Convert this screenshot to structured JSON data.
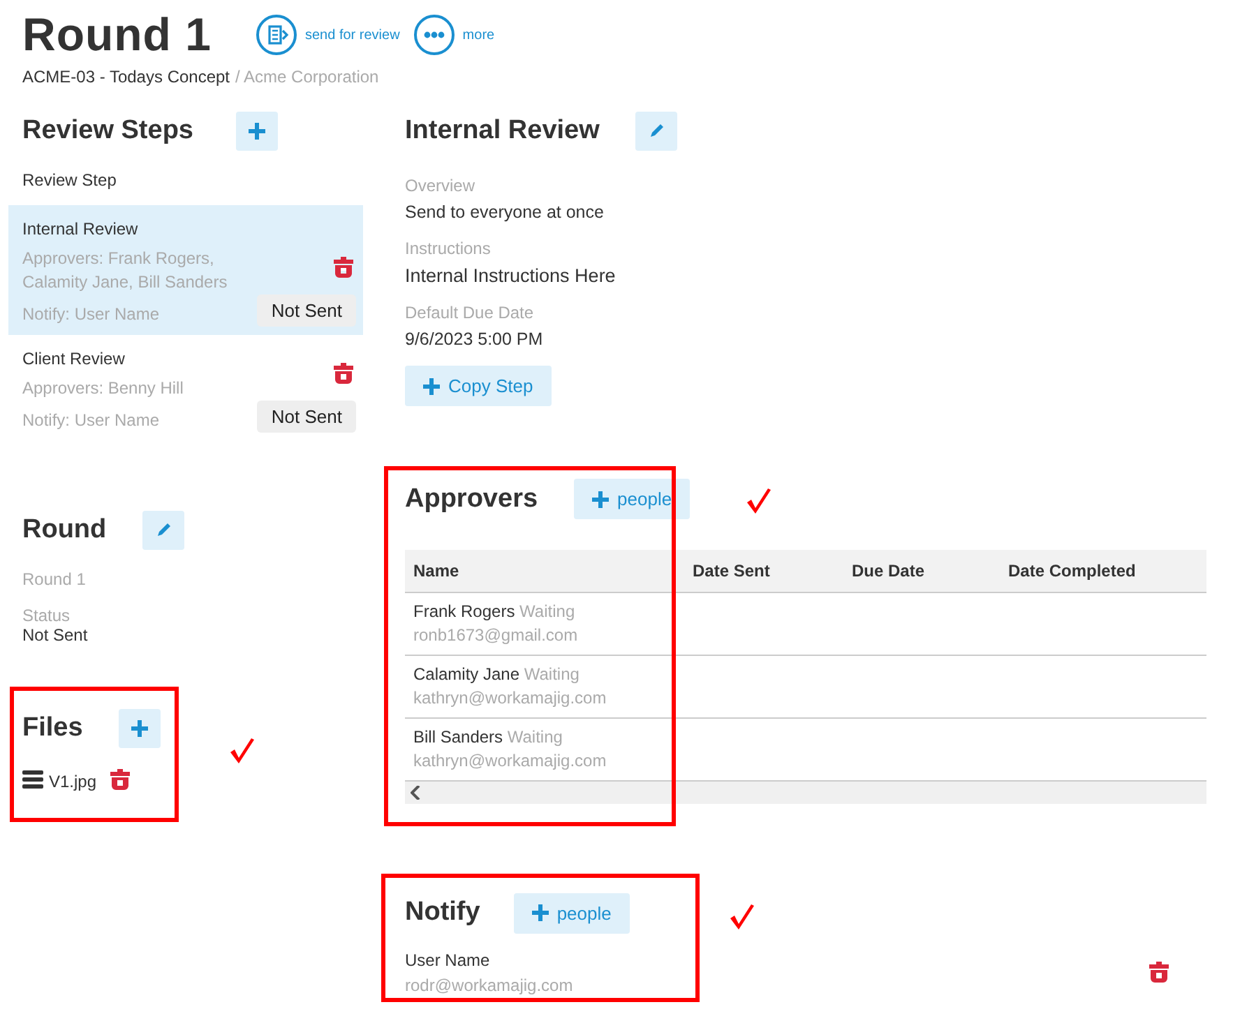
{
  "header": {
    "title": "Round 1",
    "actions": [
      {
        "kind": "send",
        "label": "send for review"
      },
      {
        "kind": "more",
        "label": "more"
      }
    ],
    "project": "ACME-03 - Todays Concept",
    "client": "/ Acme Corporation"
  },
  "review_steps": {
    "title": "Review Steps",
    "column_label": "Review Step",
    "steps": [
      {
        "name": "Internal Review",
        "approvers": "Approvers: Frank Rogers, Calamity Jane, Bill Sanders",
        "notify": "Notify: User Name",
        "status": "Not Sent",
        "selected": true
      },
      {
        "name": "Client Review",
        "approvers": "Approvers: Benny Hill",
        "notify": "Notify: User Name",
        "status": "Not Sent",
        "selected": false
      }
    ]
  },
  "round": {
    "title": "Round",
    "name": "Round 1",
    "status_label": "Status",
    "status": "Not Sent"
  },
  "files": {
    "title": "Files",
    "marked": true,
    "items": [
      {
        "name": "V1.jpg"
      }
    ]
  },
  "step_detail": {
    "title": "Internal Review",
    "fields": [
      {
        "label": "Overview",
        "value": "Send to everyone at once"
      },
      {
        "label": "Instructions",
        "value": "Internal Instructions Here"
      },
      {
        "label": "Default Due Date",
        "value": "9/6/2023 5:00 PM"
      }
    ],
    "copy_button": "Copy Step"
  },
  "approvers": {
    "title": "Approvers",
    "add_button": "people",
    "marked": true,
    "table": {
      "columns": [
        "Name",
        "Date Sent",
        "Due Date",
        "Date Completed"
      ],
      "rows": [
        {
          "name": "Frank Rogers",
          "status": "Waiting",
          "email": "ronb1673@gmail.com"
        },
        {
          "name": "Calamity Jane",
          "status": "Waiting",
          "email": "kathryn@workamajig.com"
        },
        {
          "name": "Bill Sanders",
          "status": "Waiting",
          "email": "kathryn@workamajig.com"
        }
      ]
    }
  },
  "notify": {
    "title": "Notify",
    "add_button": "people",
    "marked": true,
    "people": [
      {
        "name": "User Name",
        "email": "rodr@workamajig.com"
      }
    ]
  }
}
